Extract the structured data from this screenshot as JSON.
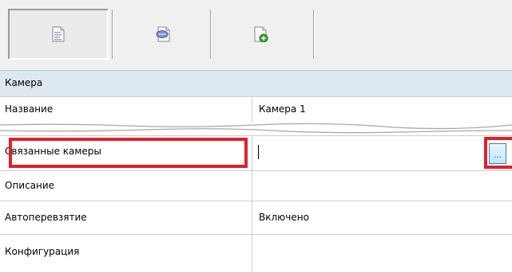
{
  "toolbar": {
    "buttons": [
      {
        "icon": "properties-page-icon",
        "active": true
      },
      {
        "icon": "comment-page-icon",
        "active": false
      },
      {
        "icon": "add-page-icon",
        "active": false
      }
    ]
  },
  "grid": {
    "category": "Камера",
    "rows_top": [
      {
        "name": "Название",
        "value": "Камера 1"
      }
    ],
    "rows_bottom": [
      {
        "name": "Связанные камеры",
        "value": ""
      },
      {
        "name": "Описание",
        "value": ""
      },
      {
        "name": "Автоперевзятие",
        "value": "Включено"
      },
      {
        "name": "Конфигурация",
        "value": ""
      }
    ],
    "ellipsis_label": "...",
    "highlight_color": "#e0202a",
    "category_bg": "#dde8f3"
  }
}
